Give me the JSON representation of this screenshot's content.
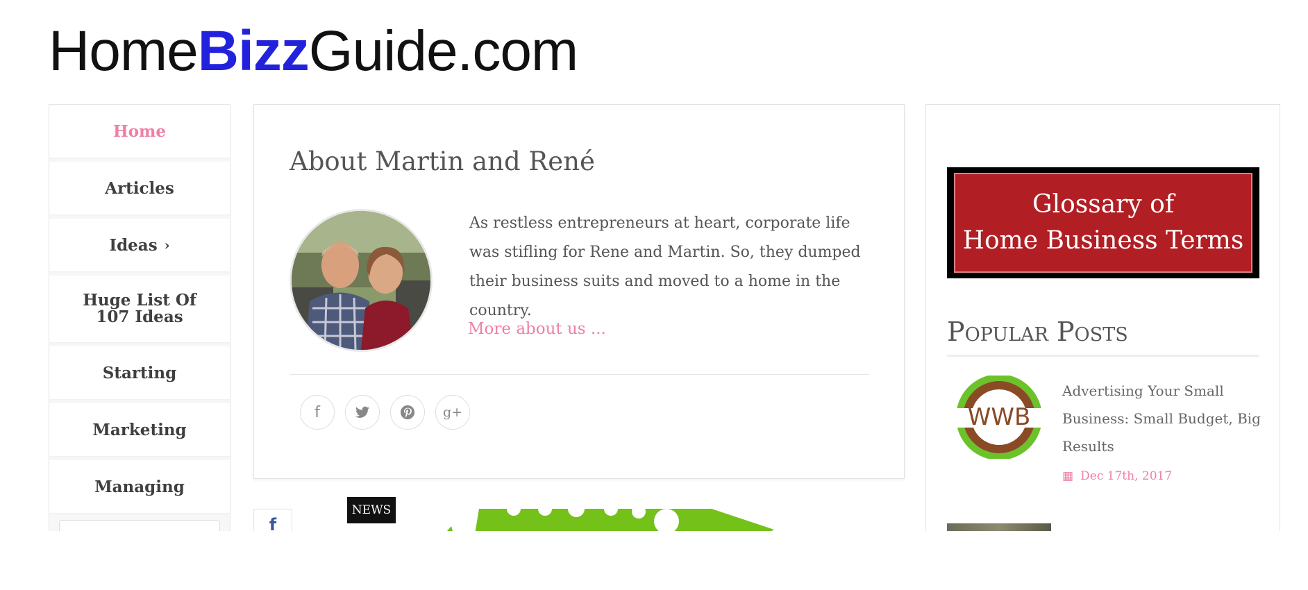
{
  "logo": {
    "part1": "Home",
    "part2": "Bizz",
    "part3": "Guide.com"
  },
  "nav": {
    "items": [
      {
        "label": "Home",
        "active": true
      },
      {
        "label": "Articles"
      },
      {
        "label": "Ideas",
        "chevron": "›"
      },
      {
        "label": "Huge List Of 107 Ideas"
      },
      {
        "label": "Starting"
      },
      {
        "label": "Marketing"
      },
      {
        "label": "Managing"
      }
    ]
  },
  "about": {
    "title": "About Martin and René",
    "text": "As restless entrepreneurs at heart, corporate life was stifling for Rene and Martin. So, they dumped their business suits and moved to a home in the country.",
    "more_link": "More about us ..."
  },
  "share": {
    "facebook_icon": "f",
    "twitter_icon": "twitter-icon",
    "pinterest_icon": "pinterest-icon",
    "googleplus_icon": "g+"
  },
  "below": {
    "fb_icon": "f",
    "badge": "NEWS"
  },
  "sidebar": {
    "banner_line1": "Glossary of",
    "banner_line2": "Home Business Terms",
    "popular_heading": "Popular Posts",
    "posts": [
      {
        "thumb_text": "WWB",
        "title": "Advertising Your Small Business: Small Budget, Big Results",
        "date": "Dec 17th, 2017"
      }
    ]
  },
  "colors": {
    "accent_pink": "#f07fa5",
    "logo_blue": "#2222dd",
    "banner_red": "#b11f24",
    "art_green": "#74c11a",
    "wwb_brown": "#8a4a26"
  }
}
